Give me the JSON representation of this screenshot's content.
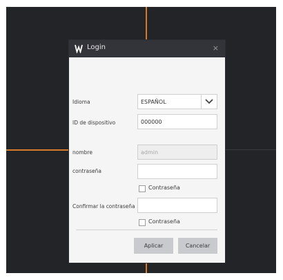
{
  "dialog": {
    "title": "Login",
    "close_glyph": "×",
    "logo_icon": "brand-logo-icon"
  },
  "form": {
    "language": {
      "label": "Idioma",
      "value": "ESPAÑOL"
    },
    "device_id": {
      "label": "ID de dispositivo",
      "value": "000000"
    },
    "username": {
      "label": "nombre",
      "value": "admin"
    },
    "password": {
      "label": "contraseña",
      "value": ""
    },
    "show_password": {
      "label": "Contraseña",
      "checked": false
    },
    "confirm_password": {
      "label": "Confirmar la contraseña",
      "value": ""
    },
    "show_confirm_password": {
      "label": "Contraseña",
      "checked": false
    }
  },
  "buttons": {
    "apply": "Aplicar",
    "cancel": "Cancelar"
  },
  "colors": {
    "background": "#232428",
    "accent_line": "#d97a2a",
    "titlebar": "#33343a",
    "dialog_body": "#f5f5f5"
  }
}
